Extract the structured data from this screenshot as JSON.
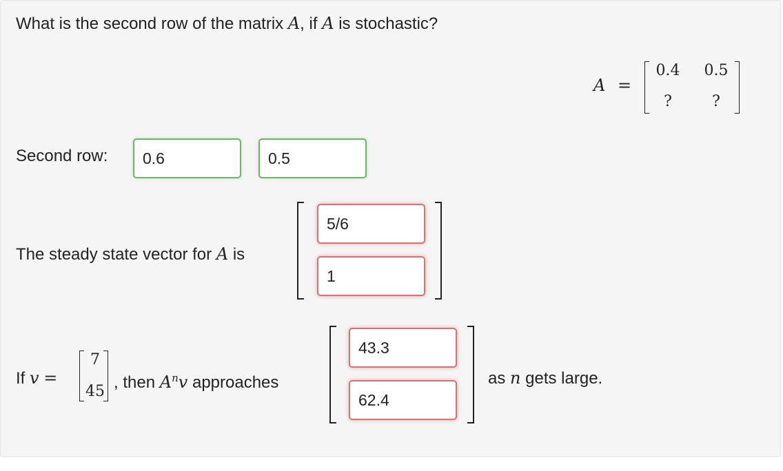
{
  "question": {
    "prefix": "What is the second row of the matrix ",
    "var": "A",
    "middle": ", if ",
    "var2": "A",
    "suffix": " is stochastic?"
  },
  "matrix": {
    "name": "A",
    "eq": "=",
    "rows": [
      [
        "0.4",
        "0.5"
      ],
      [
        "?",
        "?"
      ]
    ]
  },
  "second_row": {
    "label": "Second row:",
    "inputs": [
      "0.6",
      "0.5"
    ]
  },
  "steady_state": {
    "label": "The steady state vector for ",
    "var": "A",
    "suffix": " is",
    "inputs": [
      "5/6",
      "1"
    ]
  },
  "limit": {
    "if_text": "If ",
    "v": "v",
    "eq": "=",
    "v_entries": [
      "7",
      "45"
    ],
    "then_text": ", then ",
    "An": "A",
    "n_sup": "n",
    "v2": "v",
    "approaches": " approaches",
    "inputs": [
      "43.3",
      "62.4"
    ],
    "as_text": "as ",
    "n": "n",
    "gets_large": " gets large."
  },
  "colors": {
    "correct": "#6fb56a",
    "incorrect": "#d9726f",
    "panel": "#f5f5f5"
  }
}
